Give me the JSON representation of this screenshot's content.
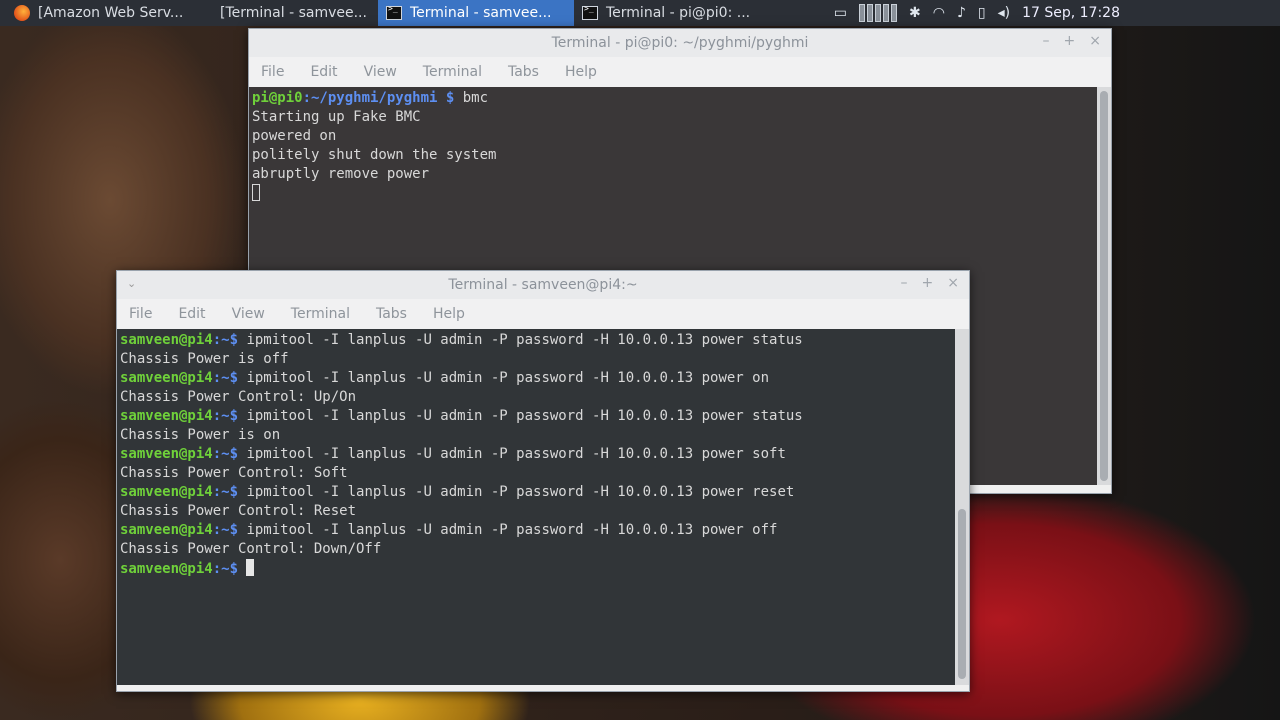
{
  "taskbar": {
    "tasks": [
      {
        "label": "[Amazon Web Serv...",
        "icon": "firefox-icon"
      },
      {
        "label": "[Terminal - samvee..."
      },
      {
        "label": "Terminal - samvee...",
        "active": true,
        "icon": "terminal-icon"
      },
      {
        "label": "Terminal - pi@pi0: ...",
        "icon": "terminal-icon"
      }
    ],
    "clock": "17 Sep, 17:28"
  },
  "back_window": {
    "title": "Terminal - pi@pi0: ~/pyghmi/pyghmi",
    "menu": [
      "File",
      "Edit",
      "View",
      "Terminal",
      "Tabs",
      "Help"
    ],
    "prompt_user": "pi@pi0",
    "prompt_path": ":~/pyghmi/pyghmi $",
    "command": " bmc",
    "output": [
      "Starting up Fake BMC",
      "powered on",
      "politely shut down the system",
      "abruptly remove power"
    ]
  },
  "front_window": {
    "title": "Terminal - samveen@pi4:~",
    "menu": [
      "File",
      "Edit",
      "View",
      "Terminal",
      "Tabs",
      "Help"
    ],
    "prompt_user": "samveen@pi4",
    "prompt_path": ":~$",
    "entries": [
      {
        "command": " ipmitool -I lanplus -U admin -P password -H 10.0.0.13 power status",
        "output": "Chassis Power is off"
      },
      {
        "command": " ipmitool -I lanplus -U admin -P password -H 10.0.0.13 power on",
        "output": "Chassis Power Control: Up/On"
      },
      {
        "command": " ipmitool -I lanplus -U admin -P password -H 10.0.0.13 power status",
        "output": "Chassis Power is on"
      },
      {
        "command": " ipmitool -I lanplus -U admin -P password -H 10.0.0.13 power soft",
        "output": "Chassis Power Control: Soft"
      },
      {
        "command": " ipmitool -I lanplus -U admin -P password -H 10.0.0.13 power reset",
        "output": "Chassis Power Control: Reset"
      },
      {
        "command": " ipmitool -I lanplus -U admin -P password -H 10.0.0.13 power off",
        "output": "Chassis Power Control: Down/Off"
      }
    ]
  }
}
